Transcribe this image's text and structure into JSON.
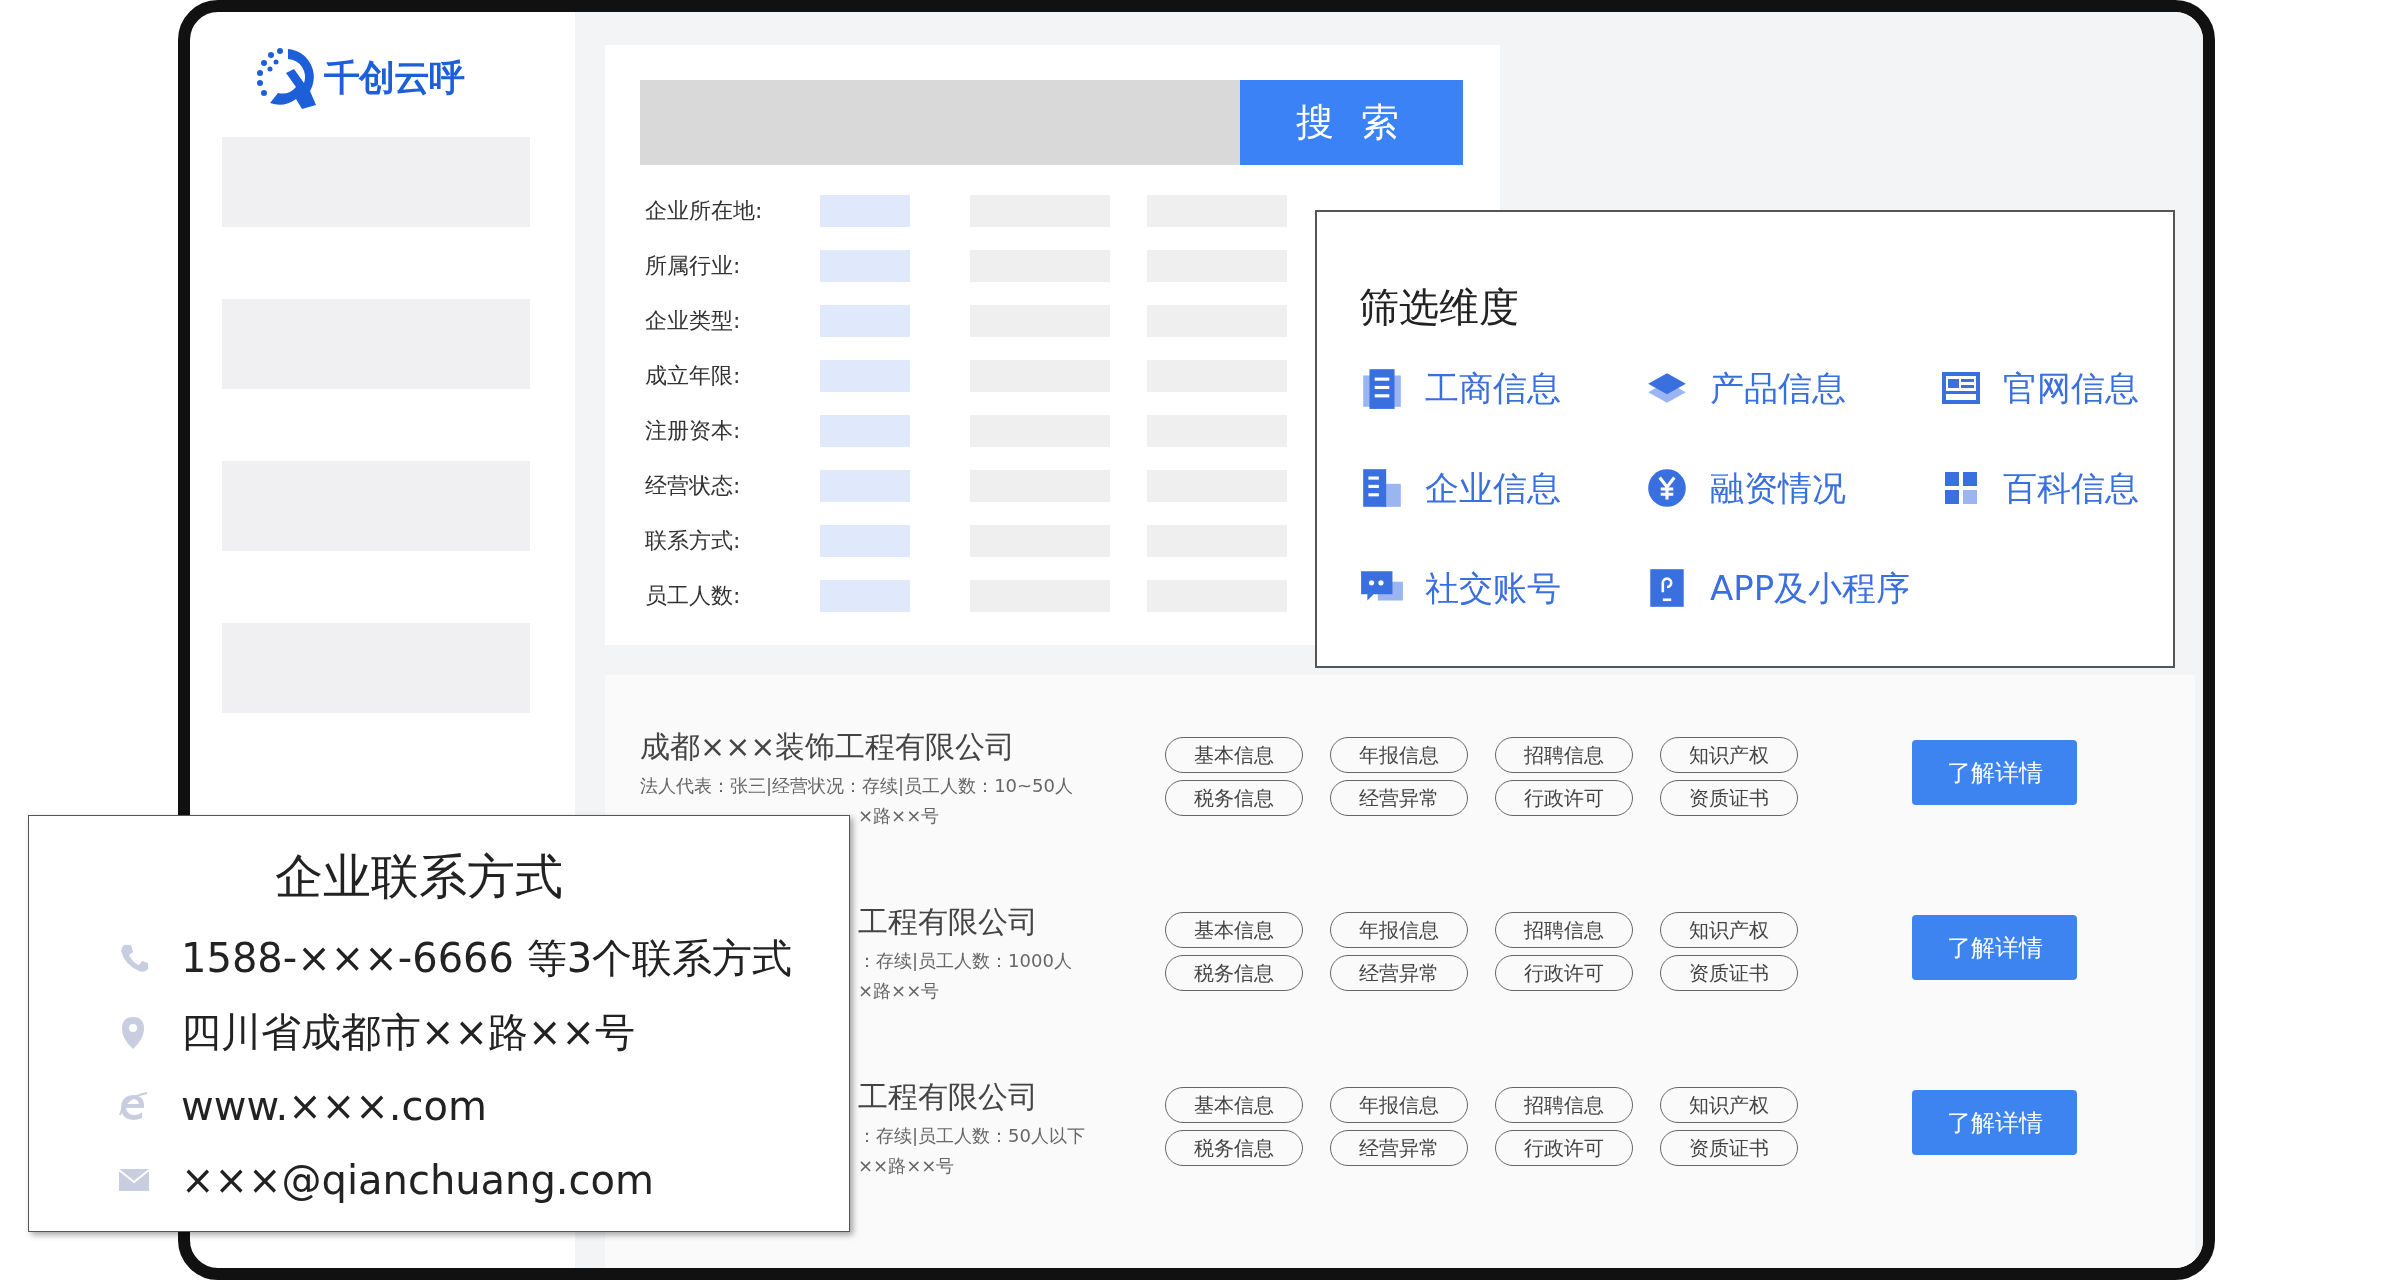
{
  "logo": {
    "text": "千创云呼"
  },
  "search": {
    "button": "搜 索"
  },
  "filters": [
    {
      "label": "企业所在地:"
    },
    {
      "label": "所属行业:"
    },
    {
      "label": "企业类型:"
    },
    {
      "label": "成立年限:"
    },
    {
      "label": "注册资本:"
    },
    {
      "label": "经营状态:"
    },
    {
      "label": "联系方式:"
    },
    {
      "label": "员工人数:"
    }
  ],
  "dimensions": {
    "title": "筛选维度",
    "items": [
      {
        "label": "工商信息"
      },
      {
        "label": "产品信息"
      },
      {
        "label": "官网信息"
      },
      {
        "label": "企业信息"
      },
      {
        "label": "融资情况"
      },
      {
        "label": "百科信息"
      },
      {
        "label": "社交账号"
      },
      {
        "label": "APP及小程序"
      }
    ]
  },
  "companies": [
    {
      "lines": [
        {
          "text": "成都×××装饰工程有限公司",
          "kind": "name",
          "cut": false
        },
        {
          "text": "法人代表：张三|经营状况：存续|员工人数：10~50人",
          "kind": "info",
          "cut": false
        },
        {
          "text": "×路××号",
          "kind": "info",
          "cut": true
        }
      ],
      "tags": [
        "基本信息",
        "年报信息",
        "招聘信息",
        "知识产权",
        "税务信息",
        "经营异常",
        "行政许可",
        "资质证书"
      ],
      "button": "了解详情"
    },
    {
      "lines": [
        {
          "text": "工程有限公司",
          "kind": "name",
          "cut": true
        },
        {
          "text": "：存续|员工人数：1000人",
          "kind": "info",
          "cut": true
        },
        {
          "text": "×路××号",
          "kind": "info",
          "cut": true
        }
      ],
      "tags": [
        "基本信息",
        "年报信息",
        "招聘信息",
        "知识产权",
        "税务信息",
        "经营异常",
        "行政许可",
        "资质证书"
      ],
      "button": "了解详情"
    },
    {
      "lines": [
        {
          "text": "工程有限公司",
          "kind": "name",
          "cut": true
        },
        {
          "text": "：存续|员工人数：50人以下",
          "kind": "info",
          "cut": true
        },
        {
          "text": "××路××号",
          "kind": "info",
          "cut": true
        }
      ],
      "tags": [
        "基本信息",
        "年报信息",
        "招聘信息",
        "知识产权",
        "税务信息",
        "经营异常",
        "行政许可",
        "资质证书"
      ],
      "button": "了解详情"
    }
  ],
  "contact": {
    "title": "企业联系方式",
    "items": [
      {
        "text": "1588-×××-6666 等3个联系方式"
      },
      {
        "text": "四川省成都市××路××号"
      },
      {
        "text": "www.×××.com"
      },
      {
        "text": "×××@qianchuang.com"
      }
    ]
  }
}
